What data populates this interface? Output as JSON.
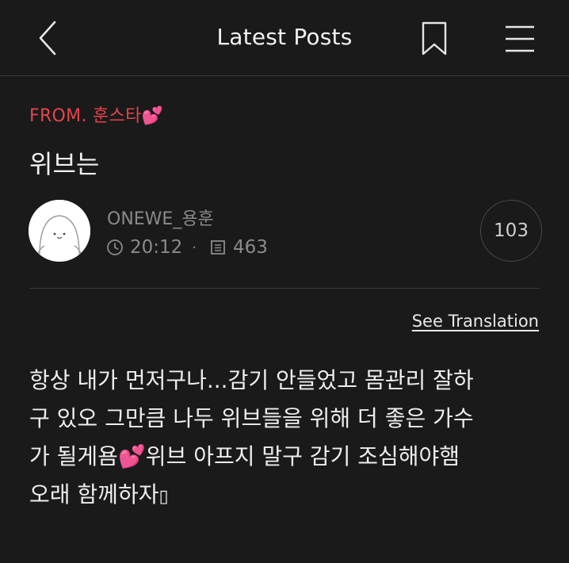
{
  "header": {
    "title": "Latest Posts"
  },
  "post": {
    "from_label": "FROM. 훈스타",
    "from_heart": "💕",
    "title": "위브는",
    "author": "ONEWE_용훈",
    "time": "20:12",
    "dot": "·",
    "views": "463",
    "reply_count": "103",
    "see_translation": "See Translation",
    "body_lines": [
      "항상 내가 먼저구나...감기 안들었고 몸관리 잘하",
      "구 있오 그만큼 나두 위브들을 위해 더 좋은 가수",
      "가 될게욤💕위브 아프지 말구 감기 조심해야햄",
      "오래 함께하자"
    ],
    "trailing_glyph": "▯"
  },
  "colors": {
    "background": "#1a1a1a",
    "from_accent": "#e5444b",
    "muted_text": "#8a8a8a"
  },
  "icons": {
    "back": "chevron-left-icon",
    "bookmark": "bookmark-icon",
    "menu": "hamburger-menu-icon",
    "time": "clock-icon",
    "views": "document-icon"
  }
}
